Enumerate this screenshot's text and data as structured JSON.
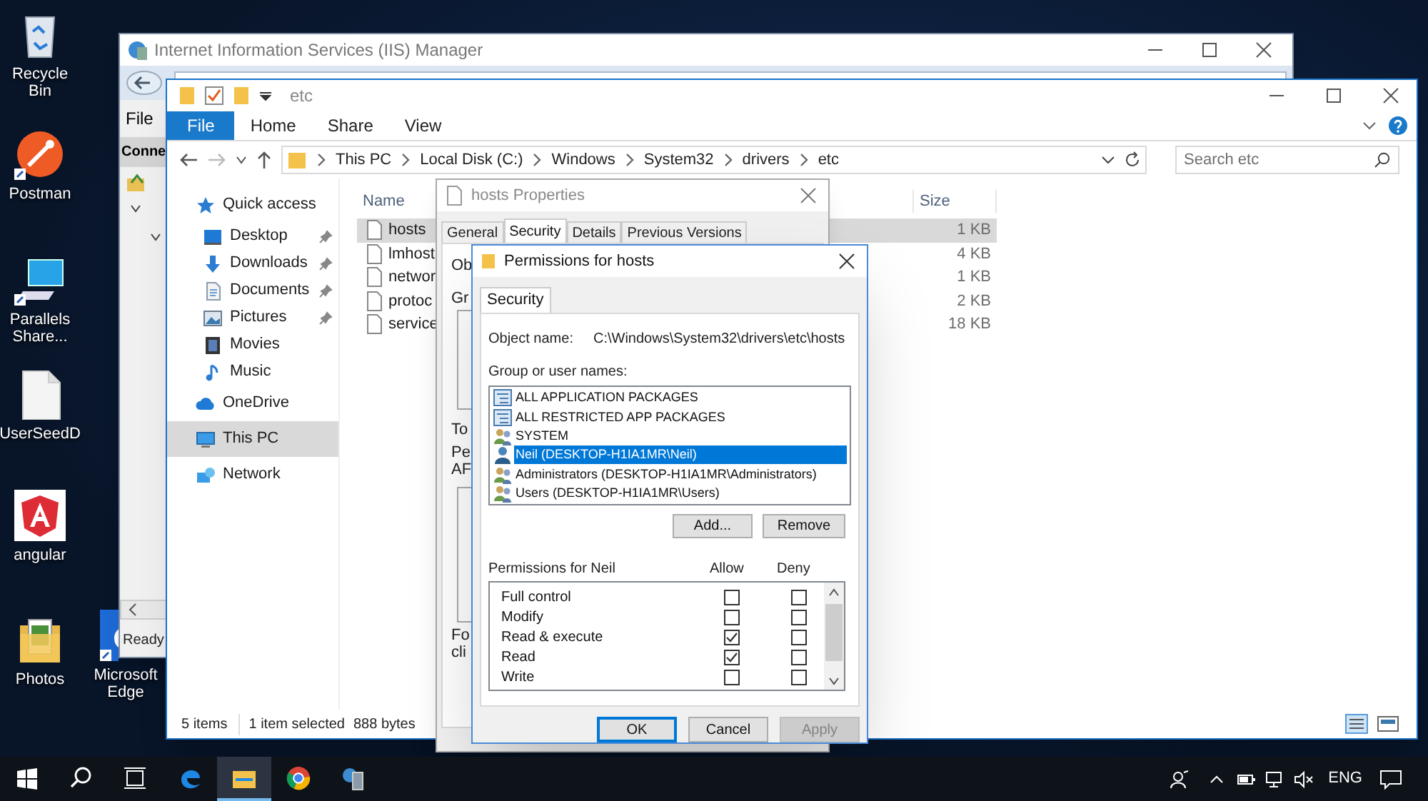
{
  "desktop_icons": [
    {
      "label": "Recycle Bin",
      "kind": "trash"
    },
    {
      "label": "Postman",
      "kind": "postman"
    },
    {
      "label": "Parallels Share...",
      "kind": "parallels"
    },
    {
      "label": "UserSeedD",
      "kind": "file"
    },
    {
      "label": "angular",
      "kind": "angular"
    },
    {
      "label": "Photos",
      "kind": "photos"
    },
    {
      "label": "Microsoft Edge",
      "kind": "edge"
    }
  ],
  "iis_manager": {
    "title": "Internet Information Services (IIS) Manager",
    "menu": [
      "File"
    ],
    "panel_header": "Conne",
    "status": "Ready"
  },
  "explorer": {
    "title": "etc",
    "ribbon_tabs": [
      {
        "label": "File",
        "selected": true
      },
      {
        "label": "Home",
        "selected": false
      },
      {
        "label": "Share",
        "selected": false
      },
      {
        "label": "View",
        "selected": false
      }
    ],
    "breadcrumb": [
      "This PC",
      "Local Disk (C:)",
      "Windows",
      "System32",
      "drivers",
      "etc"
    ],
    "search": {
      "placeholder": "Search etc"
    },
    "navigation": [
      {
        "label": "Quick access",
        "kind": "star",
        "selected": false,
        "children": [
          {
            "label": "Desktop",
            "kind": "desktop",
            "pinned": true,
            "selected": false
          },
          {
            "label": "Downloads",
            "kind": "download",
            "pinned": true,
            "selected": false
          },
          {
            "label": "Documents",
            "kind": "documents",
            "pinned": true,
            "selected": false
          },
          {
            "label": "Pictures",
            "kind": "pictures",
            "pinned": true,
            "selected": false
          },
          {
            "label": "Movies",
            "kind": "movies",
            "pinned": false,
            "selected": false
          },
          {
            "label": "Music",
            "kind": "music",
            "pinned": false,
            "selected": false
          }
        ]
      },
      {
        "label": "OneDrive",
        "kind": "cloud",
        "selected": false
      },
      {
        "label": "This PC",
        "kind": "computer",
        "selected": true
      },
      {
        "label": "Network",
        "kind": "network",
        "selected": false
      }
    ],
    "columns": [
      "Name",
      "Size"
    ],
    "files": [
      {
        "name": "hosts",
        "size": "1 KB",
        "selected": true
      },
      {
        "name": "lmhost",
        "size": "4 KB",
        "selected": false
      },
      {
        "name": "networ",
        "size": "1 KB",
        "selected": false
      },
      {
        "name": "protoc",
        "size": "2 KB",
        "selected": false
      },
      {
        "name": "service",
        "size": "18 KB",
        "selected": false
      }
    ],
    "status_bar": {
      "item_count": "5 items",
      "selection": "1 item selected",
      "selection_size": "888 bytes"
    }
  },
  "properties_dialog": {
    "title": "hosts Properties",
    "tabs": [
      {
        "label": "General",
        "selected": false
      },
      {
        "label": "Security",
        "selected": true
      },
      {
        "label": "Details",
        "selected": false
      },
      {
        "label": "Previous Versions",
        "selected": false
      }
    ],
    "labels": [
      "Ob",
      "Gr",
      "To",
      "Pe",
      "AF",
      "Fo",
      "cli"
    ]
  },
  "permissions_dialog": {
    "title": "Permissions for hosts",
    "tabs": [
      {
        "label": "Security",
        "selected": true
      }
    ],
    "object_label": "Object name:",
    "object_name": "C:\\Windows\\System32\\drivers\\etc\\hosts",
    "users_label": "Group or user names:",
    "users": [
      {
        "name": "ALL APPLICATION PACKAGES",
        "kind": "package",
        "selected": false
      },
      {
        "name": "ALL RESTRICTED APP PACKAGES",
        "kind": "package",
        "selected": false
      },
      {
        "name": "SYSTEM",
        "kind": "group",
        "selected": false
      },
      {
        "name": "Neil (DESKTOP-H1IA1MR\\Neil)",
        "kind": "user",
        "selected": true
      },
      {
        "name": "Administrators (DESKTOP-H1IA1MR\\Administrators)",
        "kind": "group",
        "selected": false
      },
      {
        "name": "Users (DESKTOP-H1IA1MR\\Users)",
        "kind": "group",
        "selected": false
      }
    ],
    "add_button": "Add...",
    "remove_button": "Remove",
    "permissions_label": "Permissions for Neil",
    "allow_header": "Allow",
    "deny_header": "Deny",
    "permissions": [
      {
        "name": "Full control",
        "allow": false,
        "deny": false
      },
      {
        "name": "Modify",
        "allow": false,
        "deny": false
      },
      {
        "name": "Read & execute",
        "allow": true,
        "deny": false
      },
      {
        "name": "Read",
        "allow": true,
        "deny": false
      },
      {
        "name": "Write",
        "allow": false,
        "deny": false
      }
    ],
    "buttons": [
      {
        "label": "OK",
        "default": true,
        "disabled": false
      },
      {
        "label": "Cancel",
        "default": false,
        "disabled": false
      },
      {
        "label": "Apply",
        "default": false,
        "disabled": true
      }
    ]
  },
  "taskbar": {
    "apps": [
      {
        "kind": "start",
        "selected": false
      },
      {
        "kind": "search",
        "selected": false
      },
      {
        "kind": "taskview",
        "selected": false
      },
      {
        "kind": "edge",
        "selected": false
      },
      {
        "kind": "explorer",
        "selected": true
      },
      {
        "kind": "chrome",
        "selected": false
      },
      {
        "kind": "iis",
        "selected": false
      }
    ],
    "language": "ENG"
  }
}
